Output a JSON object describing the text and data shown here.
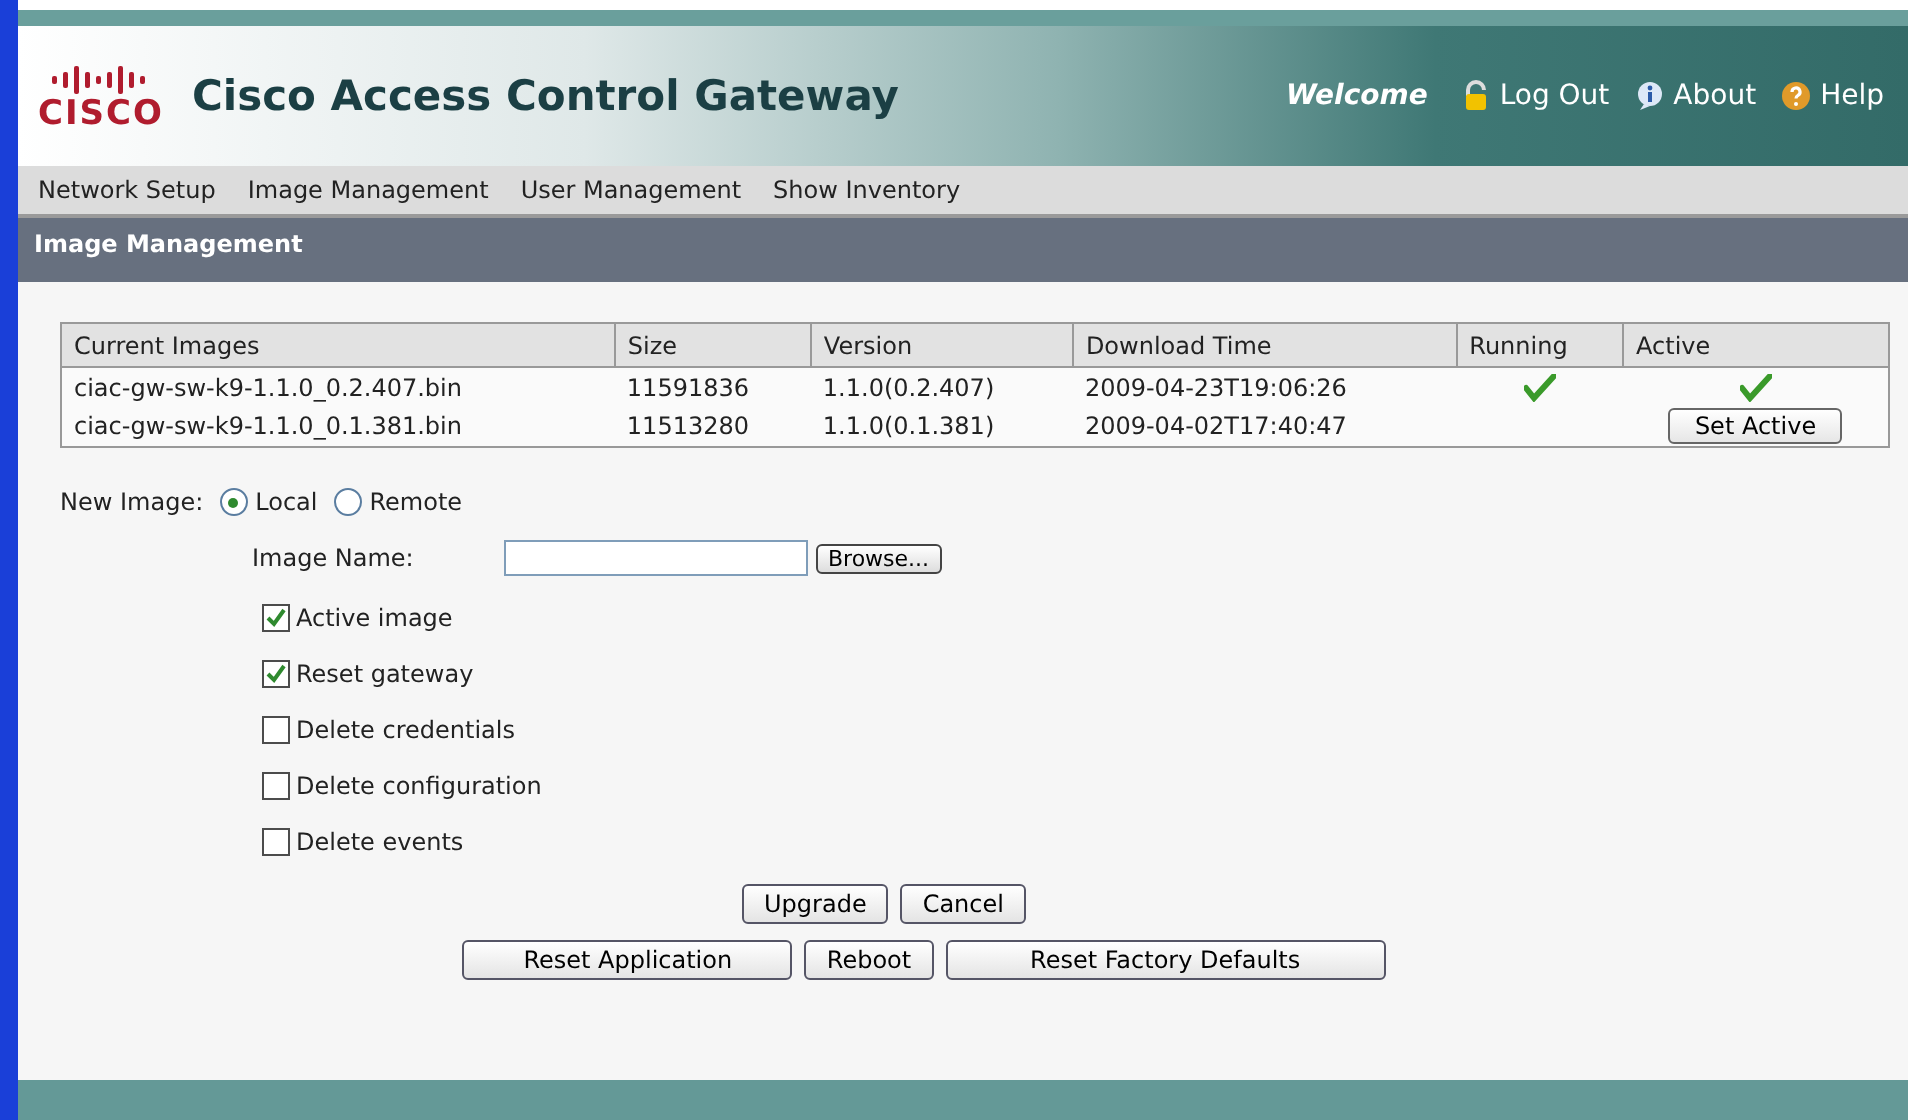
{
  "header": {
    "logo": "CISCO",
    "title": "Cisco Access Control Gateway",
    "welcome": "Welcome",
    "links": [
      {
        "label": "Log Out",
        "kind": "lock"
      },
      {
        "label": "About",
        "kind": "info"
      },
      {
        "label": "Help",
        "kind": "help"
      }
    ]
  },
  "menu": [
    {
      "label": "Network Setup"
    },
    {
      "label": "Image Management"
    },
    {
      "label": "User Management"
    },
    {
      "label": "Show Inventory"
    }
  ],
  "section_title": "Image Management",
  "table": {
    "columns": [
      "Current Images",
      "Size",
      "Version",
      "Download Time",
      "Running",
      "Active"
    ],
    "rows": [
      {
        "name": "ciac-gw-sw-k9-1.1.0_0.2.407.bin",
        "size": "11591836",
        "version": "1.1.0(0.2.407)",
        "download_time": "2009-04-23T19:06:26",
        "running": true,
        "active": true
      },
      {
        "name": "ciac-gw-sw-k9-1.1.0_0.1.381.bin",
        "size": "11513280",
        "version": "1.1.0(0.1.381)",
        "download_time": "2009-04-02T17:40:47",
        "running": false,
        "active": false,
        "set_active_button": "Set Active"
      }
    ]
  },
  "new_image": {
    "label": "New Image:",
    "sources": [
      {
        "label": "Local",
        "selected": true
      },
      {
        "label": "Remote",
        "selected": false
      }
    ],
    "image_name_label": "Image Name:",
    "browse_button": "Browse...",
    "options": [
      {
        "label": "Active image",
        "checked": true
      },
      {
        "label": "Reset gateway",
        "checked": true
      },
      {
        "label": "Delete credentials",
        "checked": false
      },
      {
        "label": "Delete configuration",
        "checked": false
      },
      {
        "label": "Delete events",
        "checked": false
      }
    ]
  },
  "buttons_row1": [
    "Upgrade",
    "Cancel"
  ],
  "buttons_row2": [
    "Reset Application",
    "Reboot",
    "Reset Factory Defaults"
  ]
}
